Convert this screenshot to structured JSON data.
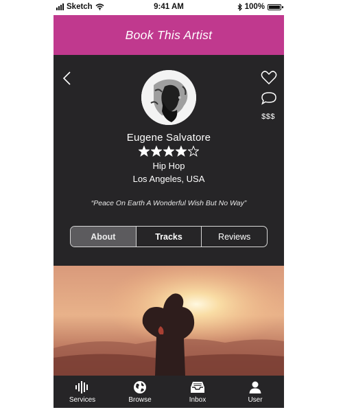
{
  "status_bar": {
    "carrier": "Sketch",
    "time": "9:41 AM",
    "battery": "100%"
  },
  "header": {
    "title": "Book This Artist"
  },
  "profile": {
    "name": "Eugene Salvatore",
    "rating": 4,
    "rating_max": 5,
    "genre": "Hip Hop",
    "location": "Los Angeles, USA",
    "quote": "“Peace On Earth A Wonderful Wish But No Way”",
    "price": "$$$",
    "icons": [
      "back-chevron-icon",
      "heart-icon",
      "chat-bubble-icon"
    ]
  },
  "tabs": [
    {
      "label": "About",
      "active": true
    },
    {
      "label": "Tracks",
      "active": false
    },
    {
      "label": "Reviews",
      "active": false
    }
  ],
  "bottom_nav": [
    {
      "label": "Services",
      "icon": "equalizer-icon"
    },
    {
      "label": "Browse",
      "icon": "globe-icon"
    },
    {
      "label": "Inbox",
      "icon": "inbox-tray-icon"
    },
    {
      "label": "User",
      "icon": "user-icon"
    }
  ],
  "colors": {
    "accent": "#c0398e",
    "dark": "#262527",
    "active_tab": "#5c5b5e"
  }
}
